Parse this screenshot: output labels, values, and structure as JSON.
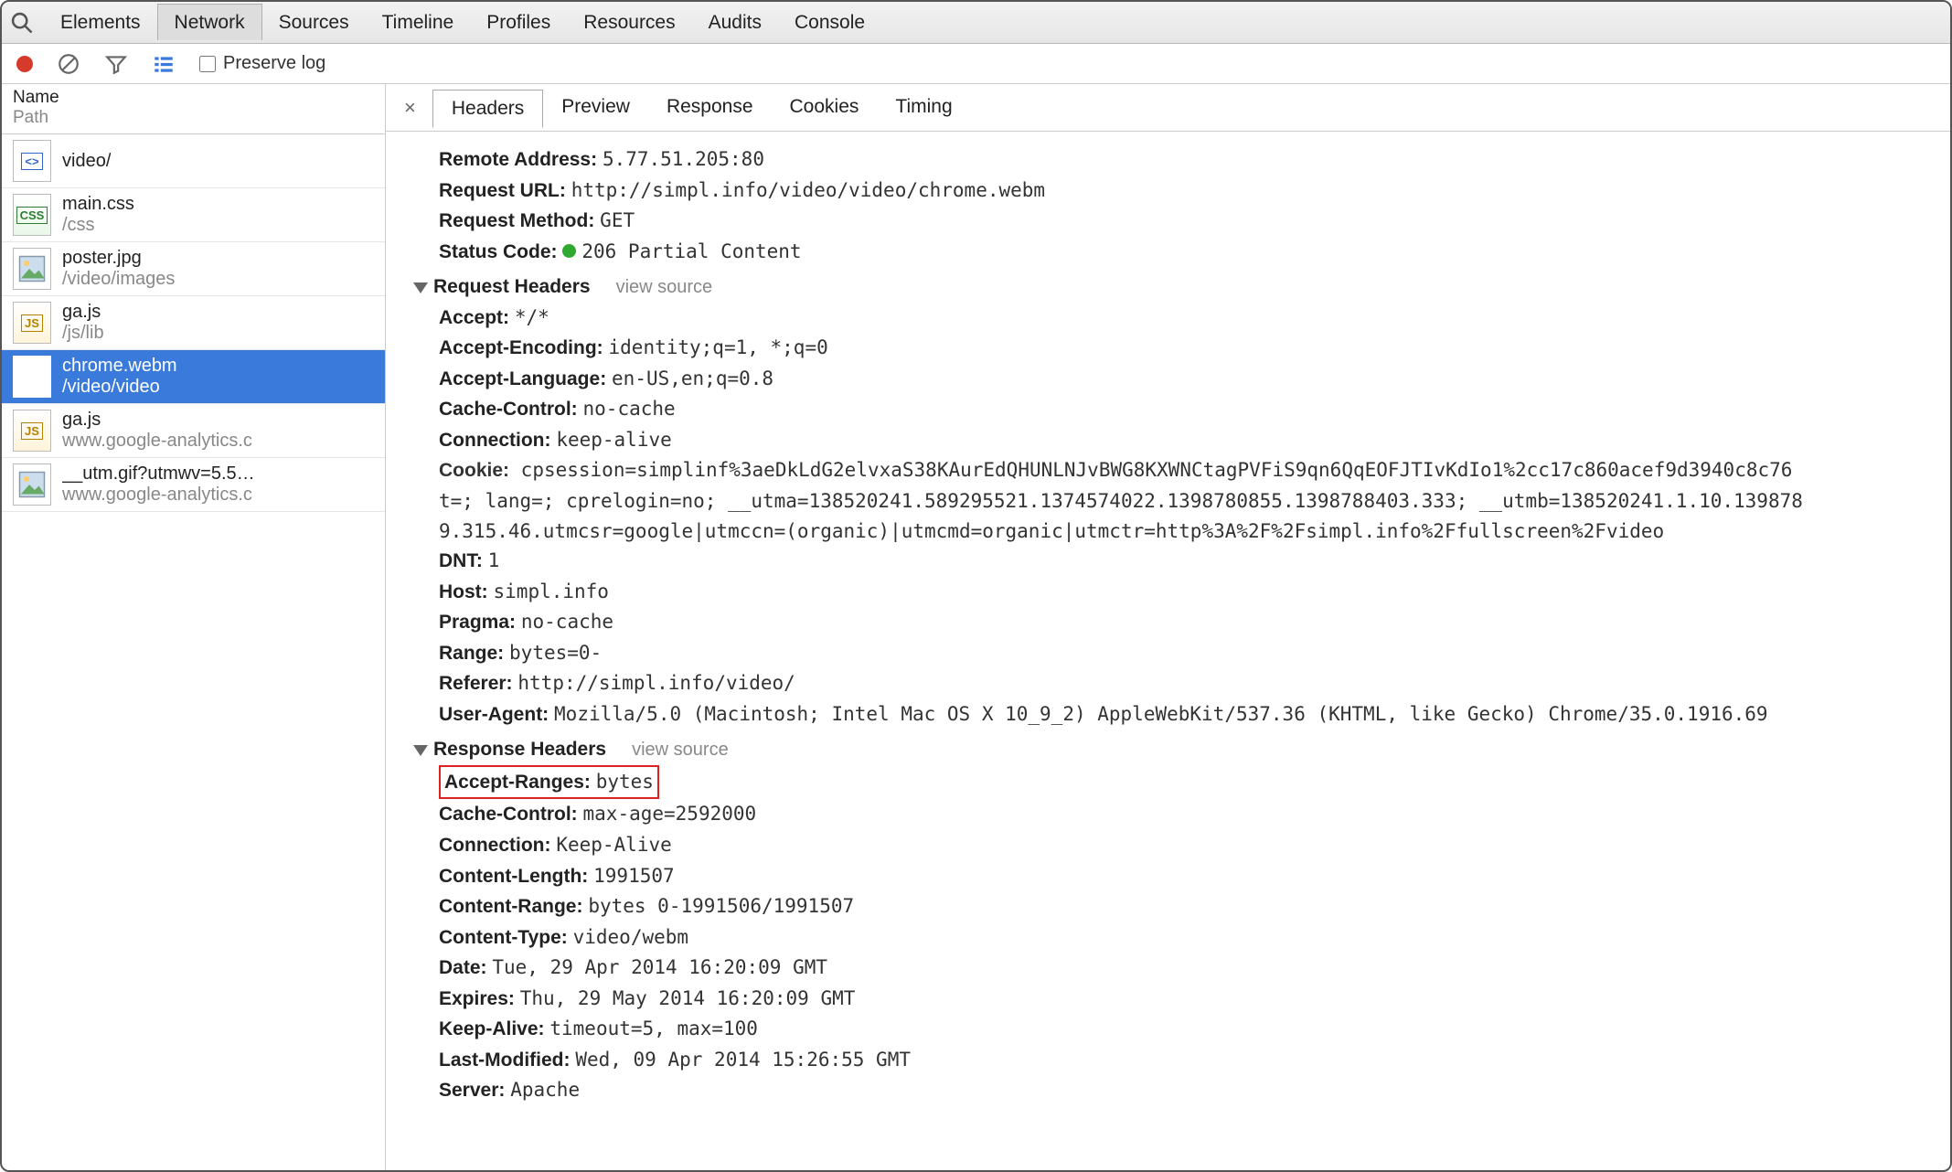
{
  "top_tabs": [
    "Elements",
    "Network",
    "Sources",
    "Timeline",
    "Profiles",
    "Resources",
    "Audits",
    "Console"
  ],
  "active_top_tab": 1,
  "toolbar": {
    "preserve_label": "Preserve log"
  },
  "sidebar": {
    "header_name": "Name",
    "header_path": "Path",
    "items": [
      {
        "name": "video/",
        "path": "",
        "type": "code",
        "selected": false
      },
      {
        "name": "main.css",
        "path": "/css",
        "type": "css",
        "selected": false
      },
      {
        "name": "poster.jpg",
        "path": "/video/images",
        "type": "img",
        "selected": false
      },
      {
        "name": "ga.js",
        "path": "/js/lib",
        "type": "js",
        "selected": false
      },
      {
        "name": "chrome.webm",
        "path": "/video/video",
        "type": "media",
        "selected": true
      },
      {
        "name": "ga.js",
        "path": "www.google-analytics.c",
        "type": "js",
        "selected": false
      },
      {
        "name": "__utm.gif?utmwv=5.5…",
        "path": "www.google-analytics.c",
        "type": "img",
        "selected": false
      }
    ]
  },
  "detail_tabs": [
    "Headers",
    "Preview",
    "Response",
    "Cookies",
    "Timing"
  ],
  "active_detail_tab": 0,
  "summary": {
    "remote_address_label": "Remote Address:",
    "remote_address_value": "5.77.51.205:80",
    "request_url_label": "Request URL:",
    "request_url_value": "http://simpl.info/video/video/chrome.webm",
    "request_method_label": "Request Method:",
    "request_method_value": "GET",
    "status_code_label": "Status Code:",
    "status_code_value": "206 Partial Content"
  },
  "sections": {
    "request_title": "Request Headers",
    "response_title": "Response Headers",
    "view_source": "view source"
  },
  "request_headers": [
    {
      "k": "Accept:",
      "v": "*/*"
    },
    {
      "k": "Accept-Encoding:",
      "v": "identity;q=1, *;q=0"
    },
    {
      "k": "Accept-Language:",
      "v": "en-US,en;q=0.8"
    },
    {
      "k": "Cache-Control:",
      "v": "no-cache"
    },
    {
      "k": "Connection:",
      "v": "keep-alive"
    }
  ],
  "cookie": {
    "label": "Cookie:",
    "line1": "cpsession=simplinf%3aeDkLdG2elvxaS38KAurEdQHUNLNJvBWG8KXWNCtagPVFiS9qn6QqEOFJTIvKdIo1%2cc17c860acef9d3940c8c76",
    "line2": "t=; lang=; cprelogin=no; __utma=138520241.589295521.1374574022.1398780855.1398788403.333; __utmb=138520241.1.10.139878",
    "line3": "9.315.46.utmcsr=google|utmccn=(organic)|utmcmd=organic|utmctr=http%3A%2F%2Fsimpl.info%2Ffullscreen%2Fvideo"
  },
  "request_headers2": [
    {
      "k": "DNT:",
      "v": "1"
    },
    {
      "k": "Host:",
      "v": "simpl.info"
    },
    {
      "k": "Pragma:",
      "v": "no-cache"
    },
    {
      "k": "Range:",
      "v": "bytes=0-"
    },
    {
      "k": "Referer:",
      "v": "http://simpl.info/video/"
    },
    {
      "k": "User-Agent:",
      "v": "Mozilla/5.0 (Macintosh; Intel Mac OS X 10_9_2) AppleWebKit/537.36 (KHTML, like Gecko) Chrome/35.0.1916.69"
    }
  ],
  "response_headers": [
    {
      "k": "Accept-Ranges:",
      "v": "bytes",
      "highlight": true
    },
    {
      "k": "Cache-Control:",
      "v": "max-age=2592000"
    },
    {
      "k": "Connection:",
      "v": "Keep-Alive"
    },
    {
      "k": "Content-Length:",
      "v": "1991507"
    },
    {
      "k": "Content-Range:",
      "v": "bytes 0-1991506/1991507"
    },
    {
      "k": "Content-Type:",
      "v": "video/webm"
    },
    {
      "k": "Date:",
      "v": "Tue, 29 Apr 2014 16:20:09 GMT"
    },
    {
      "k": "Expires:",
      "v": "Thu, 29 May 2014 16:20:09 GMT"
    },
    {
      "k": "Keep-Alive:",
      "v": "timeout=5, max=100"
    },
    {
      "k": "Last-Modified:",
      "v": "Wed, 09 Apr 2014 15:26:55 GMT"
    },
    {
      "k": "Server:",
      "v": "Apache"
    }
  ]
}
